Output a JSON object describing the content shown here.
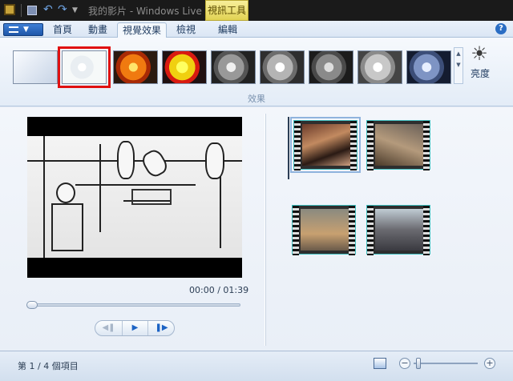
{
  "window": {
    "title": "我的影片 - Windows Live Mo",
    "context_tab": "視訊工具"
  },
  "tabs": [
    {
      "label": "首頁"
    },
    {
      "label": "動畫"
    },
    {
      "label": "視覺效果",
      "active": true
    },
    {
      "label": "檢視"
    },
    {
      "label": "編輯"
    }
  ],
  "ribbon": {
    "effects_group_label": "效果",
    "brightness_label": "亮度",
    "effects": [
      "none",
      "sketch",
      "orange",
      "yellow",
      "gray1",
      "gray2",
      "gray3",
      "gray4",
      "blue"
    ],
    "selected_effect": 1
  },
  "preview": {
    "time_display": "00:00 / 01:39",
    "seek_fraction": 0
  },
  "storyboard": {
    "clips": [
      "clip-1",
      "clip-2",
      "clip-3",
      "clip-4"
    ],
    "selected_clip": 0
  },
  "status": {
    "item_count": "第 1 / 4 個項目"
  },
  "colors": {
    "selection_outline": "#e01010",
    "accent": "#1c63c4"
  }
}
